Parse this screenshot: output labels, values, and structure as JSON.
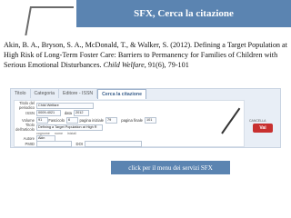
{
  "slide": {
    "title": "SFX, Cerca la citazione",
    "citation_plain": "Akin, B. A., Bryson, S. A., McDonald, T., & Walker, S. (2012). Defining a Target Population at High Risk of Long-Term Foster Care: Barriers to Permanency for Families of Children with Serious Emotional Disturbances. ",
    "citation_journal": "Child Welfare",
    "citation_tail": ", 91(6), 79-101",
    "tip_text": "click per il menu dei servizi SFX"
  },
  "screenshot": {
    "tabs": [
      {
        "label": "Titolo"
      },
      {
        "label": "Categoria"
      },
      {
        "label": "Editore - ISSN"
      },
      {
        "label": "Cerca la citazione"
      }
    ],
    "fields": {
      "periodico_label": "Titolo del periodico",
      "periodico_value": "Child Welfare",
      "issn_label": "ISSN",
      "issn_value": "0009-4021",
      "data_label": "data",
      "data_value": "2012",
      "volume_label": "Volume",
      "volume_value": "91",
      "fascicolo_label": "Fascicolo",
      "fascicolo_value": "6",
      "pagina_iniziale_label": "pagina iniziale",
      "pagina_iniziale_value": "79",
      "pagina_finale_label": "pagina finale",
      "pagina_finale_value": "101",
      "titolo_articolo_label": "Titolo dell'articolo",
      "titolo_articolo_value": "Defining a Target Population at High R",
      "cognome_label": "cognome",
      "nome_label": "nome",
      "iniziali_label": "iniziali",
      "autore_label": "Autore",
      "autore_value": "Akin",
      "pmid_label": "PMID",
      "doi_label": "DOI"
    },
    "cancella_label": "CANCELLA",
    "vai_label": "Vai"
  },
  "colors": {
    "accent": "#5b84b1",
    "vai": "#c8302f"
  }
}
